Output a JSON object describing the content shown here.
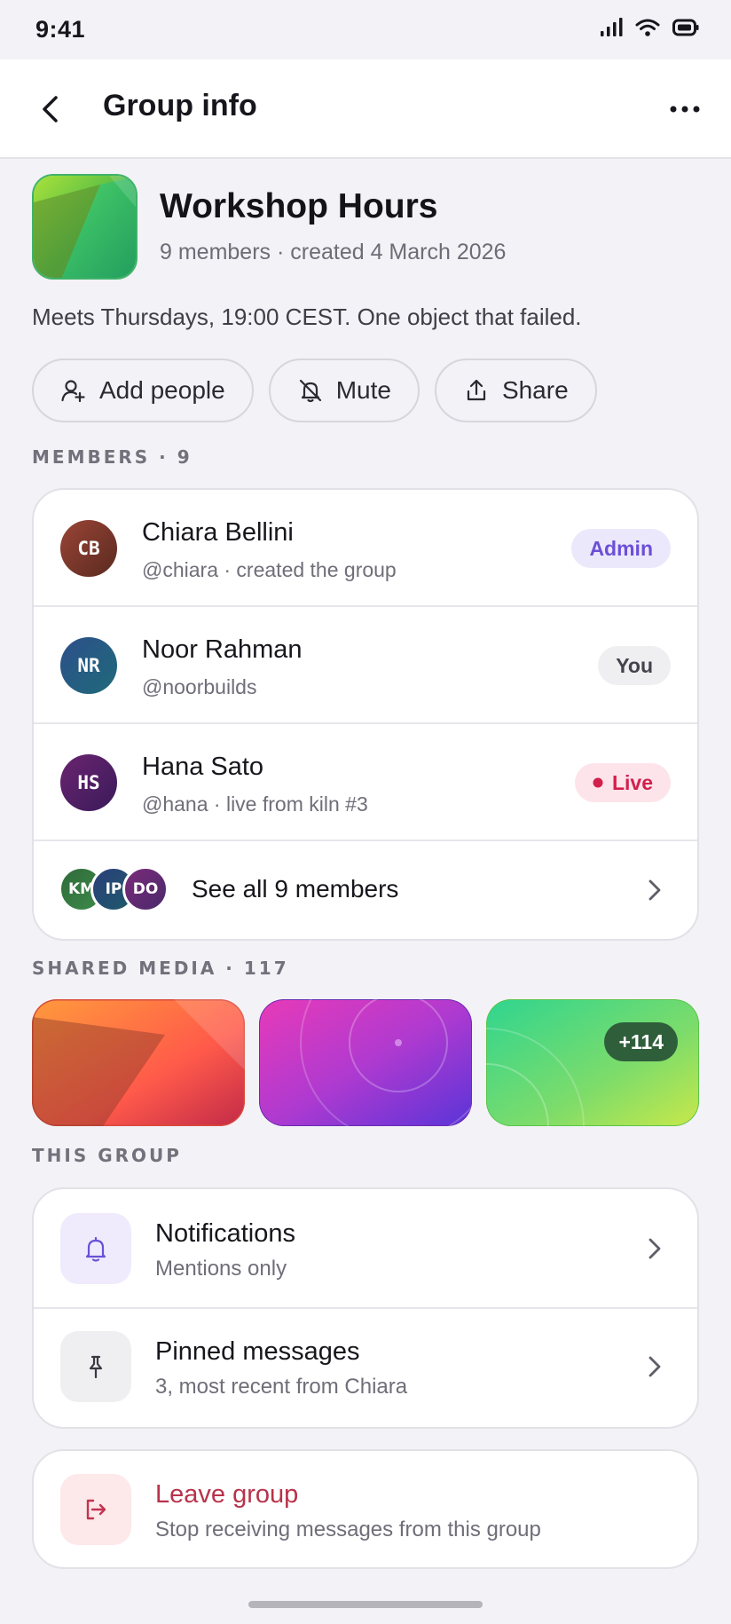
{
  "status": {
    "time": "9:41"
  },
  "appbar": {
    "title": "Group info"
  },
  "group": {
    "name": "Workshop Hours",
    "meta": "9 members · created 4 March 2026",
    "description": "Meets Thursdays, 19:00 CEST. One object that failed."
  },
  "actions": {
    "add": "Add people",
    "mute": "Mute",
    "share": "Share"
  },
  "members": {
    "label": "MEMBERS · 9",
    "items": [
      {
        "initials": "CB",
        "name": "Chiara Bellini",
        "sub": "@chiara · created the group",
        "badge": "Admin"
      },
      {
        "initials": "NR",
        "name": "Noor Rahman",
        "sub": "@noorbuilds",
        "badge": "You"
      },
      {
        "initials": "HS",
        "name": "Hana Sato",
        "sub": "@hana · live from kiln #3",
        "badge": "Live"
      }
    ],
    "stack": [
      "KM",
      "IP",
      "DO"
    ],
    "see_all": "See all 9 members"
  },
  "media": {
    "label": "SHARED MEDIA · 117",
    "more": "+114"
  },
  "this_group": {
    "label": "THIS GROUP",
    "notifications": {
      "title": "Notifications",
      "sub": "Mentions only"
    },
    "pinned": {
      "title": "Pinned messages",
      "sub": "3, most recent from Chiara"
    }
  },
  "leave": {
    "title": "Leave group",
    "sub": "Stop receiving messages from this group"
  },
  "colors": {
    "accent": "#6b4fd8",
    "danger": "#b8324b",
    "live": "#d21f4c"
  }
}
